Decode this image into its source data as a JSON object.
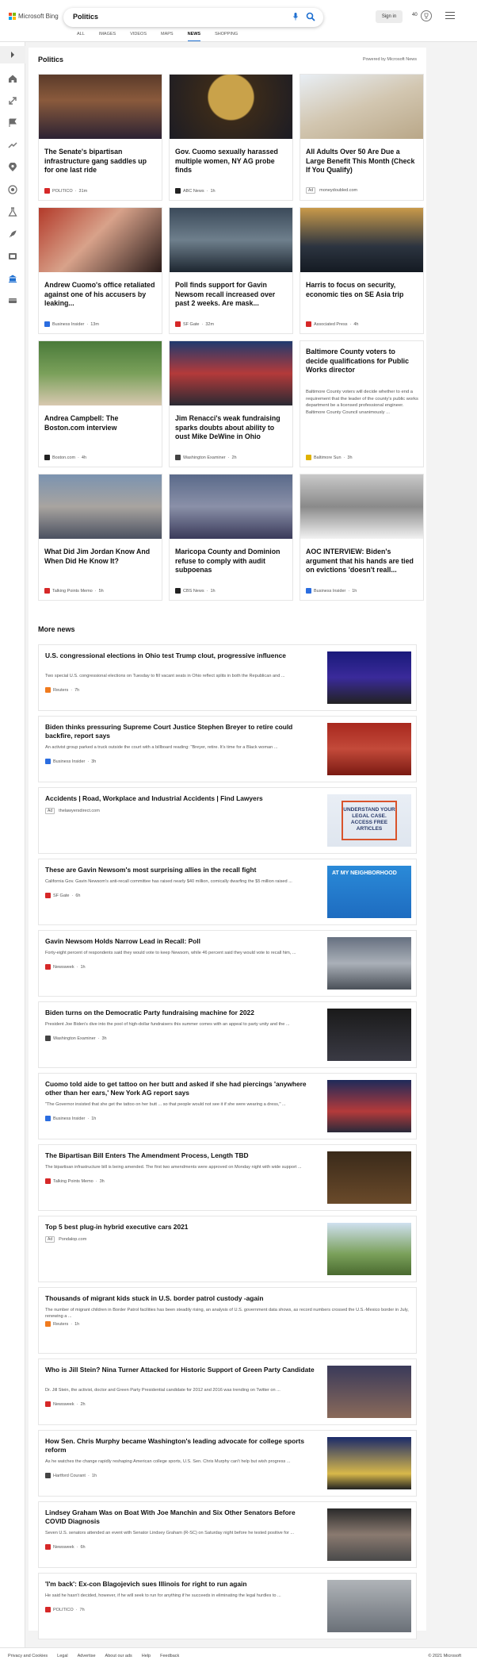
{
  "header": {
    "logo_text": "Microsoft Bing",
    "search_value": "Politics",
    "signin_label": "Sign in",
    "points": "40",
    "tabs": [
      "ALL",
      "IMAGES",
      "VIDEOS",
      "MAPS",
      "NEWS",
      "SHOPPING"
    ],
    "active_tab": "NEWS"
  },
  "section": {
    "title": "Politics",
    "powered": "Powered by Microsoft News"
  },
  "cards": [
    {
      "title": "The Senate's bipartisan infrastructure gang saddles up for one last ride",
      "source": "POLITICO",
      "time": "31m",
      "fav": "#d62828",
      "ad": ""
    },
    {
      "title": "Gov. Cuomo sexually harassed multiple women, NY AG probe finds",
      "source": "ABC News",
      "time": "1h",
      "fav": "#222",
      "ad": ""
    },
    {
      "title": "All Adults Over 50 Are Due a Large Benefit This Month (Check If You Qualify)",
      "source": "moneydoubled.com",
      "time": "",
      "fav": "",
      "ad": "Ad"
    },
    {
      "title": "Andrew Cuomo's office retaliated against one of his accusers by leaking...",
      "source": "Business Insider",
      "time": "13m",
      "fav": "#2b6de0",
      "ad": ""
    },
    {
      "title": "Poll finds support for Gavin Newsom recall increased over past 2 weeks. Are mask...",
      "source": "SF Gate",
      "time": "32m",
      "fav": "#d62828",
      "ad": ""
    },
    {
      "title": "Harris to focus on security, economic ties on SE Asia trip",
      "source": "Associated Press",
      "time": "4h",
      "fav": "#d62828",
      "ad": ""
    },
    {
      "title": "Andrea Campbell: The Boston.com interview",
      "source": "Boston.com",
      "time": "4h",
      "fav": "#222",
      "ad": ""
    },
    {
      "title": "Jim Renacci's weak fundraising sparks doubts about ability to oust Mike DeWine in Ohio",
      "source": "Washington Examiner",
      "time": "2h",
      "fav": "#444",
      "ad": ""
    },
    {
      "title": "Baltimore County voters to decide qualifications for Public Works director",
      "source": "Baltimore Sun",
      "time": "3h",
      "fav": "#e0b200",
      "ad": "",
      "snippet": "Baltimore County voters will decide whether to end a requirement that the leader of the county's public works department be a licensed professional engineer. Baltimore County Council unanimously ..."
    },
    {
      "title": "What Did Jim Jordan Know And When Did He Know It?",
      "source": "Talking Points Memo",
      "time": "5h",
      "fav": "#d62828",
      "ad": ""
    },
    {
      "title": "Maricopa County and Dominion refuse to comply with audit subpoenas",
      "source": "CBS News",
      "time": "1h",
      "fav": "#222",
      "ad": ""
    },
    {
      "title": "AOC INTERVIEW: Biden's argument that his hands are tied on evictions 'doesn't reall...",
      "source": "Business Insider",
      "time": "1h",
      "fav": "#2b6de0",
      "ad": ""
    }
  ],
  "more_news": {
    "title": "More news",
    "items": [
      {
        "title": "U.S. congressional elections in Ohio test Trump clout, progressive influence",
        "snippet": "Two special U.S. congressional elections on Tuesday to fill vacant seats in Ohio reflect splits in both the Republican and ...",
        "source": "Reuters",
        "time": "7h",
        "fav": "#f07b1e",
        "ad": ""
      },
      {
        "title": "Biden thinks pressuring Supreme Court Justice Stephen Breyer to retire could backfire, report says",
        "snippet": "An activist group parked a truck outside the court with a billboard reading: \"Breyer, retire. It's time for a Black woman ...",
        "source": "Business Insider",
        "time": "3h",
        "fav": "#2b6de0",
        "ad": ""
      },
      {
        "title": "Accidents | Road, Workplace and Industrial Accidents | Find Lawyers",
        "snippet": "",
        "source": "thelawyersdirect.com",
        "time": "",
        "fav": "",
        "ad": "Ad",
        "img_text": "UNDERSTAND YOUR LEGAL CASE. ACCESS FREE ARTICLES"
      },
      {
        "title": "These are Gavin Newsom's most surprising allies in the recall fight",
        "snippet": "California Gov. Gavin Newsom's anti-recall committee has raised nearly $40 million, comically dwarfing the $5 million raised ...",
        "source": "SF Gate",
        "time": "6h",
        "fav": "#d62828",
        "ad": "",
        "img_text": "AT MY NEIGHBORHOOD"
      },
      {
        "title": "Gavin Newsom Holds Narrow Lead in Recall: Poll",
        "snippet": "Forty-eight percent of respondents said they would vote to keep Newsom, while 46 percent said they would vote to recall him, ...",
        "source": "Newsweek",
        "time": "1h",
        "fav": "#d62828",
        "ad": ""
      },
      {
        "title": "Biden turns on the Democratic Party fundraising machine for 2022",
        "snippet": "President Joe Biden's dive into the pool of high-dollar fundraisers this summer comes with an appeal to party unity and the ...",
        "source": "Washington Examiner",
        "time": "3h",
        "fav": "#444",
        "ad": ""
      },
      {
        "title": "Cuomo told aide to get tattoo on her butt and asked if she had piercings 'anywhere other than her ears,' New York AG report says",
        "snippet": "\"The Governor insisted that she get the tattoo on her butt ... so that people would not see it if she were wearing a dress,\" ...",
        "source": "Business Insider",
        "time": "1h",
        "fav": "#2b6de0",
        "ad": ""
      },
      {
        "title": "The Bipartisan Bill Enters The Amendment Process, Length TBD",
        "snippet": "The bipartisan infrastructure bill is being amended. The first two amendments were approved on Monday night with wide support ...",
        "source": "Talking Points Memo",
        "time": "3h",
        "fav": "#d62828",
        "ad": ""
      },
      {
        "title": "Top 5 best plug-in hybrid executive cars 2021",
        "snippet": "",
        "source": "Pondalop.com",
        "time": "",
        "fav": "",
        "ad": "Ad"
      },
      {
        "title": "Thousands of migrant kids stuck in U.S. border patrol custody -again",
        "snippet": "The number of migrant children in Border Patrol facilities has been steadily rising, an analysis of U.S. government data shows, as record numbers crossed the U.S.-Mexico border in July, renewing a ...",
        "source": "Reuters",
        "time": "1h",
        "fav": "#f07b1e",
        "ad": "",
        "noimg": true
      },
      {
        "title": "Who is Jill Stein? Nina Turner Attacked for Historic Support of Green Party Candidate",
        "snippet": "Dr. Jill Stein, the activist, doctor and Green Party Presidential candidate for 2012 and 2016 was trending on Twitter on ...",
        "source": "Newsweek",
        "time": "2h",
        "fav": "#d62828",
        "ad": ""
      },
      {
        "title": "How Sen. Chris Murphy became Washington's leading advocate for college sports reform",
        "snippet": "As he watches the change rapidly reshaping American college sports, U.S. Sen. Chris Murphy can't help but wish progress ...",
        "source": "Hartford Courant",
        "time": "1h",
        "fav": "#444",
        "ad": ""
      },
      {
        "title": "Lindsey Graham Was on Boat With Joe Manchin and Six Other Senators Before COVID Diagnosis",
        "snippet": "Seven U.S. senators attended an event with Senator Lindsey Graham (R-SC) on Saturday night before he tested positive for ...",
        "source": "Newsweek",
        "time": "6h",
        "fav": "#d62828",
        "ad": ""
      },
      {
        "title": "'I'm back': Ex-con Blagojevich sues Illinois for right to run again",
        "snippet": "He said he hasn't decided, however, if he will seek to run for anything if he succeeds in eliminating the legal hurdles to ...",
        "source": "POLITICO",
        "time": "7h",
        "fav": "#d62828",
        "ad": ""
      }
    ]
  },
  "footer": {
    "links": [
      "Privacy and Cookies",
      "Legal",
      "Advertise",
      "About our ads",
      "Help",
      "Feedback"
    ],
    "copyright": "© 2021 Microsoft"
  }
}
